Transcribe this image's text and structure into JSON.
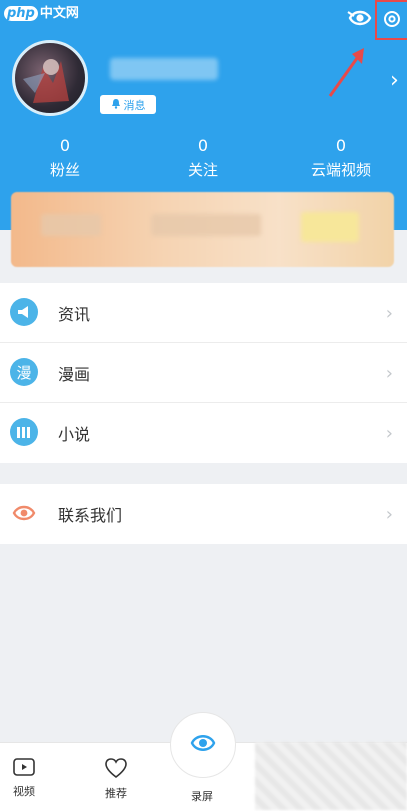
{
  "watermark": {
    "php": "php",
    "site": "中文网"
  },
  "profile": {
    "message_badge": "消息"
  },
  "stats": [
    {
      "count": "0",
      "label": "粉丝"
    },
    {
      "count": "0",
      "label": "关注"
    },
    {
      "count": "0",
      "label": "云端视频"
    }
  ],
  "menu_main": [
    {
      "label": "资讯",
      "icon": "megaphone-icon"
    },
    {
      "label": "漫画",
      "icon": "comic-icon",
      "glyph": "漫"
    },
    {
      "label": "小说",
      "icon": "book-icon"
    }
  ],
  "menu_contact": {
    "label": "联系我们",
    "icon": "contact-icon"
  },
  "tabs": [
    {
      "label": "视频",
      "icon": "video-icon"
    },
    {
      "label": "推荐",
      "icon": "heart-icon"
    },
    {
      "label": "录屏",
      "icon": "record-icon"
    }
  ],
  "colors": {
    "brand": "#2ea2ec",
    "annotation": "#e84a4a",
    "contact": "#f08a6a"
  },
  "chevron": "›"
}
